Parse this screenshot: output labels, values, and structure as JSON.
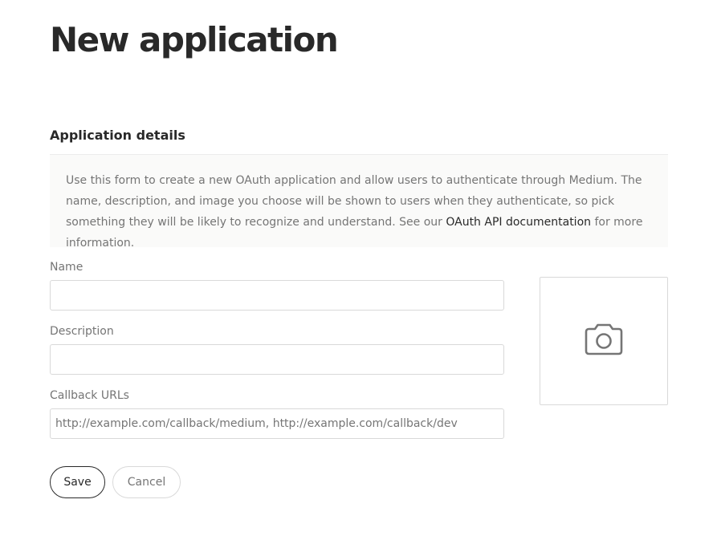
{
  "page": {
    "title": "New application"
  },
  "details": {
    "section_title": "Application details",
    "description_text": "Use this form to create a new OAuth application and allow users to authenticate through Medium. The name, description, and image you choose will be shown to users when they authenticate, so pick something they will be likely to recognize and understand. See our ",
    "doc_link_label": "OAuth API documentation",
    "description_suffix": " for more information."
  },
  "form": {
    "name": {
      "label": "Name",
      "value": "",
      "placeholder": ""
    },
    "description": {
      "label": "Description",
      "value": "",
      "placeholder": ""
    },
    "callback_urls": {
      "label": "Callback URLs",
      "value": "",
      "placeholder": "http://example.com/callback/medium, http://example.com/callback/dev"
    },
    "image_upload": {
      "icon": "camera-icon"
    }
  },
  "actions": {
    "save_label": "Save",
    "cancel_label": "Cancel"
  },
  "colors": {
    "text_primary": "#292929",
    "text_secondary": "#757575",
    "border": "#d9d9d9",
    "info_background": "#fafaf9"
  }
}
